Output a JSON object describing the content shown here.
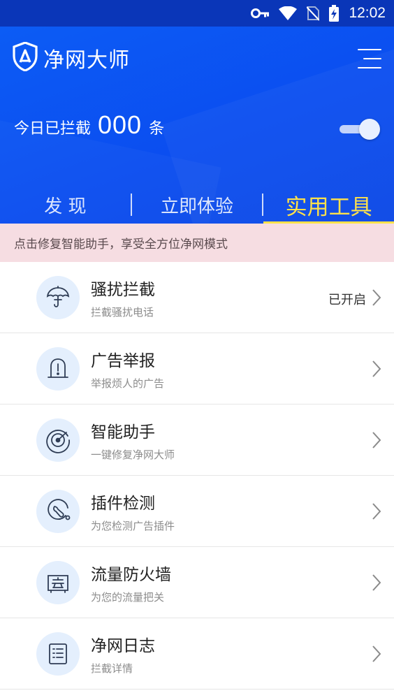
{
  "status_bar": {
    "time": "12:02",
    "icons": [
      "vpn-key-icon",
      "wifi-icon",
      "no-sim-icon",
      "battery-charging-icon"
    ]
  },
  "app": {
    "name": "净网大师",
    "logo_icon": "shield-a-logo",
    "menu_icon": "menu-icon"
  },
  "block_counter": {
    "label": "今日已拦截",
    "count": "000",
    "unit": "条",
    "toggle_on": true
  },
  "tabs": [
    {
      "label": "发 现",
      "active": false
    },
    {
      "label": "立即体验",
      "active": false
    },
    {
      "label": "实用工具",
      "active": true
    }
  ],
  "notice": {
    "text": "点击修复智能助手，享受全方位净网模式"
  },
  "tools": [
    {
      "title": "骚扰拦截",
      "subtitle": "拦截骚扰电话",
      "status": "已开启",
      "icon": "umbrella-icon"
    },
    {
      "title": "广告举报",
      "subtitle": "举报烦人的广告",
      "status": "",
      "icon": "alert-sign-icon"
    },
    {
      "title": "智能助手",
      "subtitle": "一键修复净网大师",
      "status": "",
      "icon": "radar-icon"
    },
    {
      "title": "插件检测",
      "subtitle": "为您检测广告插件",
      "status": "",
      "icon": "wrench-icon"
    },
    {
      "title": "流量防火墙",
      "subtitle": "为您的流量把关",
      "status": "",
      "icon": "firewall-icon"
    },
    {
      "title": "净网日志",
      "subtitle": "拦截详情",
      "status": "",
      "icon": "log-list-icon"
    }
  ],
  "colors": {
    "header_blue": "#0b4ef0",
    "status_bar": "#0a36b8",
    "active_tab": "#ffe14a",
    "notice_bg": "#f6dde2",
    "icon_circle_bg": "#e4effd"
  }
}
